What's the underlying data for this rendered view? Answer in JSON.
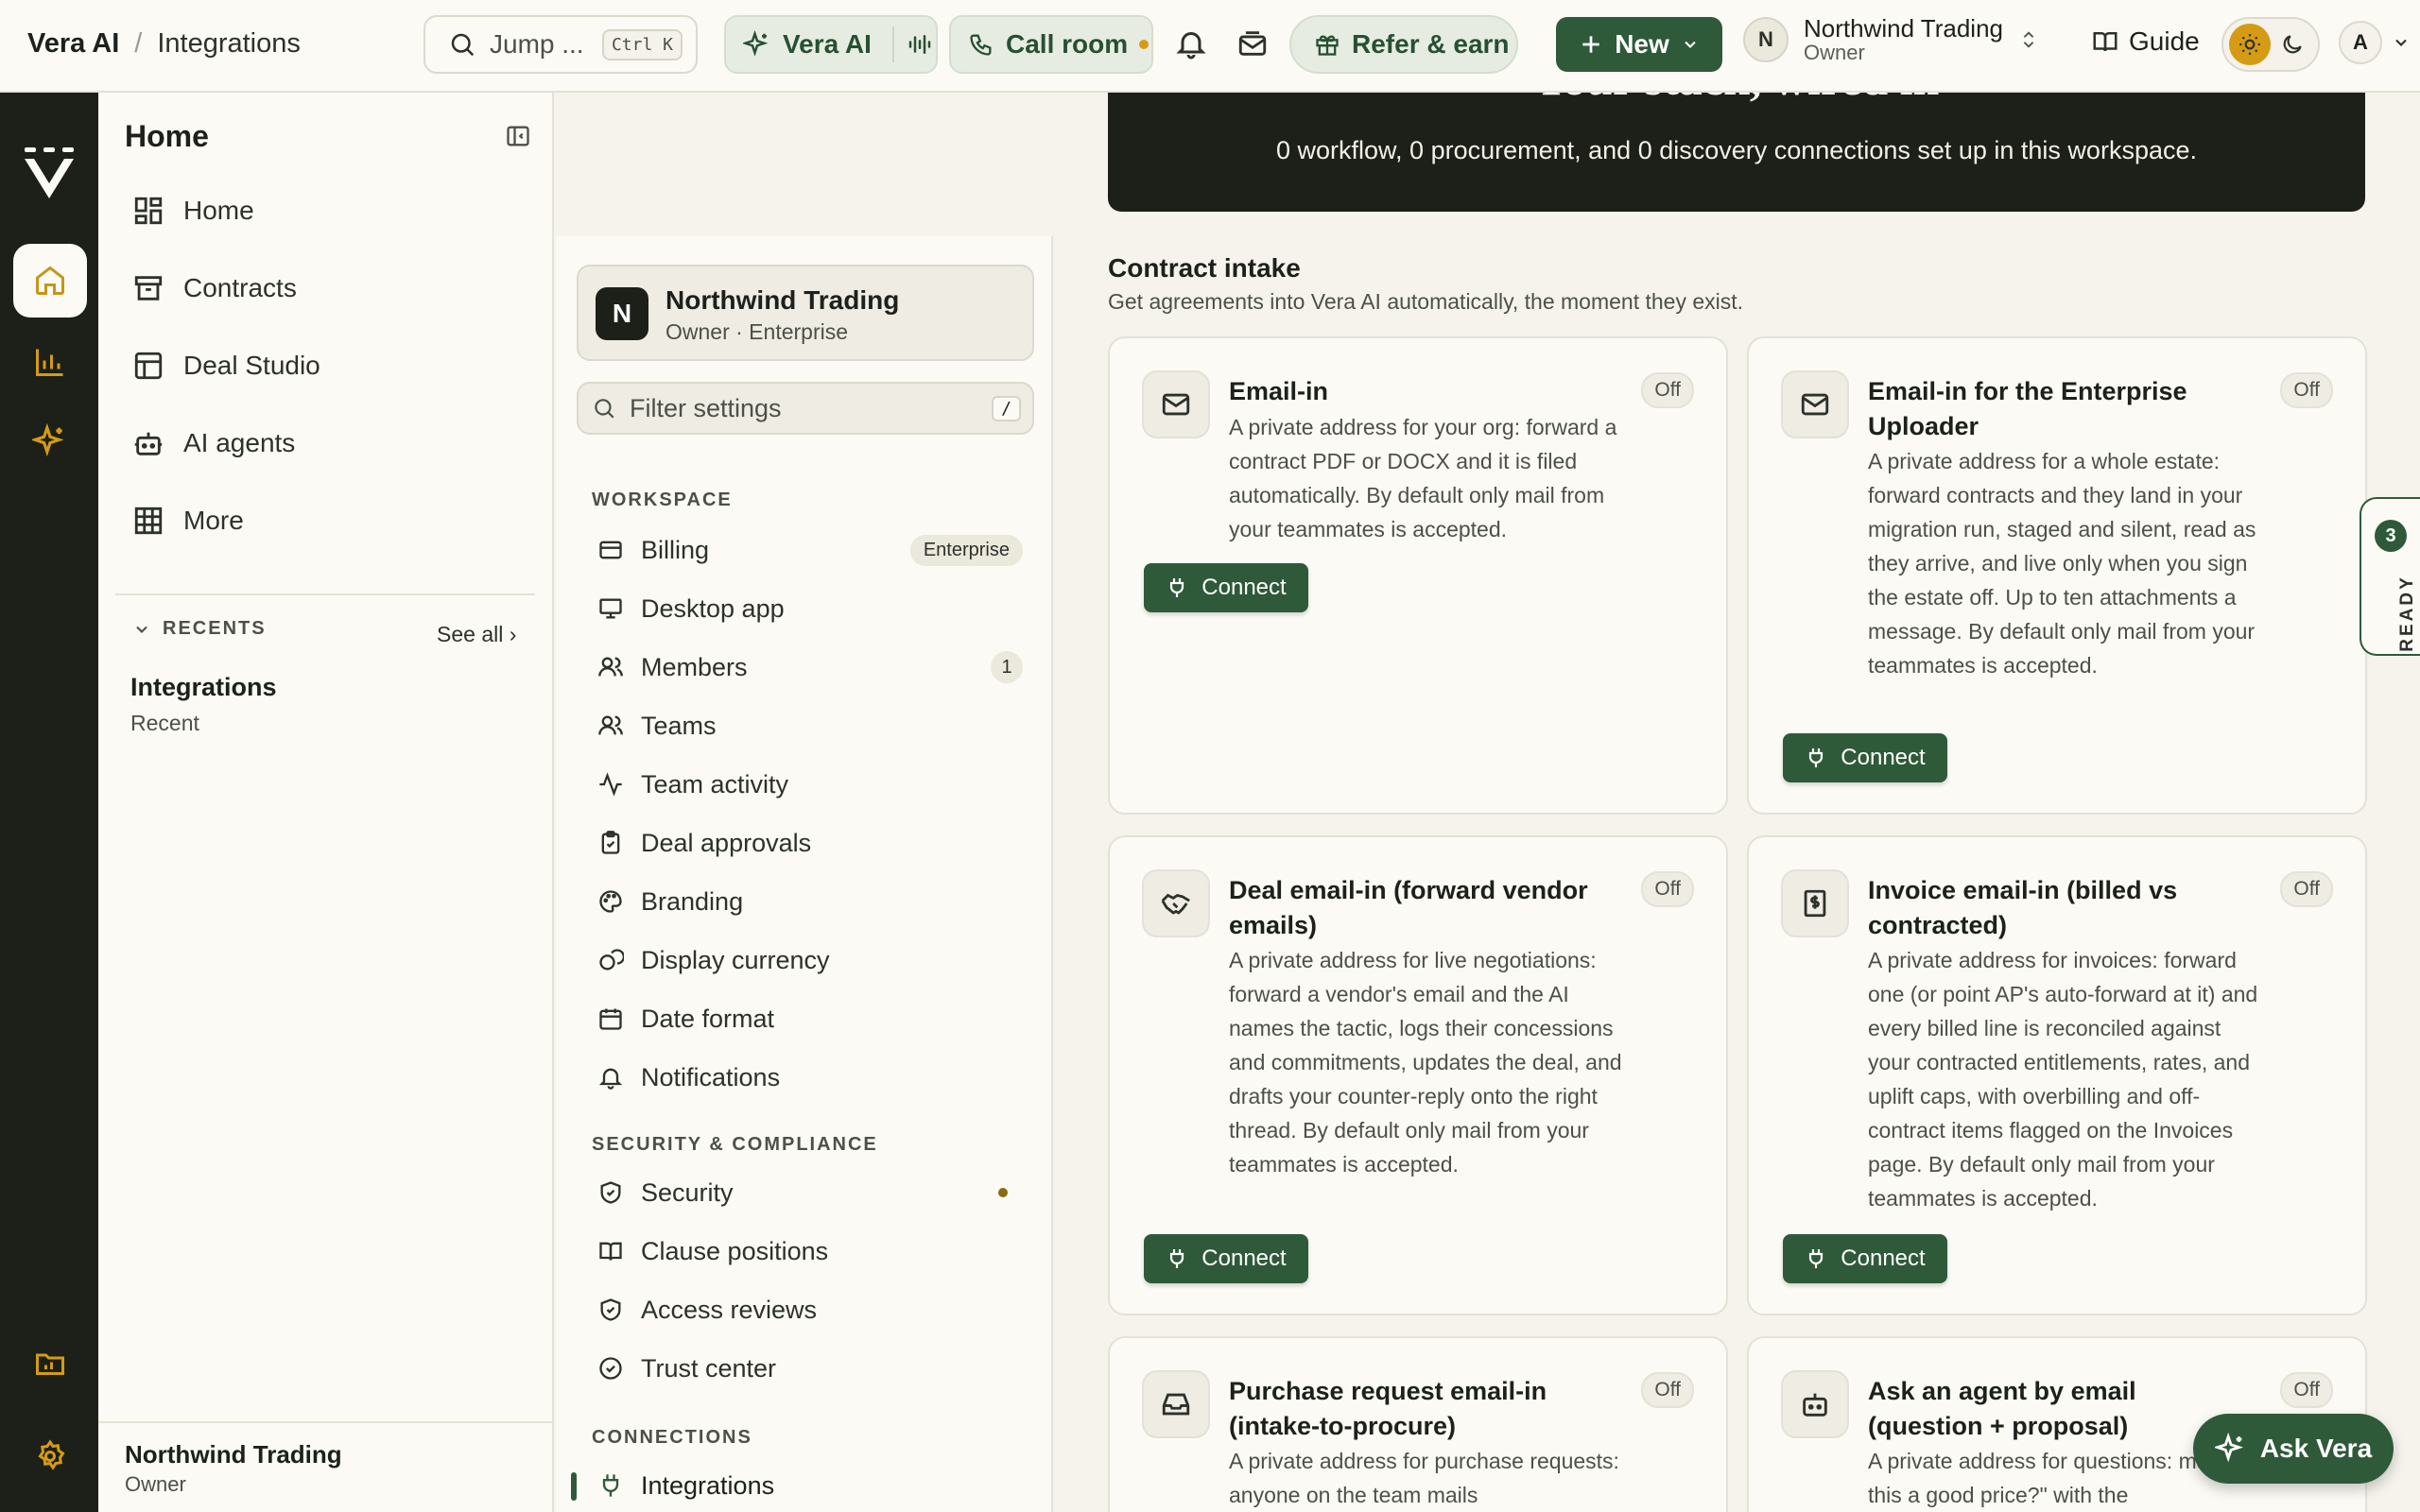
{
  "topbar": {
    "app_name": "Vera AI",
    "separator": "/",
    "page_name": "Integrations",
    "jump_label": "Jump ...",
    "jump_shortcut": "Ctrl K",
    "vera_label": "Vera AI",
    "call_label": "Call room",
    "refer_label": "Refer & earn",
    "new_label": "New",
    "workspace_initial": "N",
    "workspace_name": "Northwind Trading",
    "workspace_role": "Owner",
    "guide_label": "Guide",
    "user_initial": "A"
  },
  "sidebar": {
    "header": "Home",
    "items": [
      {
        "label": "Home",
        "icon": "grid-icon"
      },
      {
        "label": "Contracts",
        "icon": "archive-icon"
      },
      {
        "label": "Deal Studio",
        "icon": "layout-icon"
      },
      {
        "label": "AI agents",
        "icon": "bot-icon"
      },
      {
        "label": "More",
        "icon": "table-icon"
      }
    ],
    "recents_label": "RECENTS",
    "see_all": "See all ›",
    "recent_title": "Integrations",
    "recent_sub": "Recent",
    "footer_name": "Northwind Trading",
    "footer_role": "Owner"
  },
  "settings": {
    "org_initial": "N",
    "org_name": "Northwind Trading",
    "org_sub": "Owner · Enterprise",
    "filter_placeholder": "Filter settings",
    "filter_shortcut": "/",
    "sections": {
      "workspace": "WORKSPACE",
      "security": "SECURITY & COMPLIANCE",
      "connections": "CONNECTIONS"
    },
    "workspace_items": [
      {
        "label": "Billing",
        "badge": "Enterprise"
      },
      {
        "label": "Desktop app"
      },
      {
        "label": "Members",
        "count": "1"
      },
      {
        "label": "Teams"
      },
      {
        "label": "Team activity"
      },
      {
        "label": "Deal approvals"
      },
      {
        "label": "Branding"
      },
      {
        "label": "Display currency"
      },
      {
        "label": "Date format"
      },
      {
        "label": "Notifications"
      }
    ],
    "security_items": [
      {
        "label": "Security"
      },
      {
        "label": "Clause positions"
      },
      {
        "label": "Access reviews"
      },
      {
        "label": "Trust center"
      }
    ],
    "connection_items": [
      {
        "label": "Integrations"
      }
    ]
  },
  "banner": {
    "title": "Your stack, wired in",
    "subtitle": "0 workflow, 0 procurement, and 0 discovery connections set up in this workspace."
  },
  "contract_intake": {
    "title": "Contract intake",
    "description": "Get agreements into Vera AI automatically, the moment they exist.",
    "cards": [
      {
        "title": "Email-in",
        "status": "Off",
        "description": "A private address for your org: forward a contract PDF or DOCX and it is filed automatically. By default only mail from your teammates is accepted.",
        "button": "Connect",
        "icon": "mail-icon"
      },
      {
        "title": "Email-in for the Enterprise Uploader",
        "status": "Off",
        "description": "A private address for a whole estate: forward contracts and they land in your migration run, staged and silent, read as they arrive, and live only when you sign the estate off. Up to ten attachments a message. By default only mail from your teammates is accepted.",
        "button": "Connect",
        "icon": "mail-icon"
      },
      {
        "title": "Deal email-in (forward vendor emails)",
        "status": "Off",
        "description": "A private address for live negotiations: forward a vendor's email and the AI names the tactic, logs their concessions and commitments, updates the deal, and drafts your counter-reply onto the right thread. By default only mail from your teammates is accepted.",
        "button": "Connect",
        "icon": "handshake-icon"
      },
      {
        "title": "Invoice email-in (billed vs contracted)",
        "status": "Off",
        "description": "A private address for invoices: forward one (or point AP's auto-forward at it) and every billed line is reconciled against your contracted entitlements, rates, and uplift caps, with overbilling and off-contract items flagged on the Invoices page. By default only mail from your teammates is accepted.",
        "button": "Connect",
        "icon": "receipt-icon"
      },
      {
        "title": "Purchase request email-in (intake-to-procure)",
        "status": "Off",
        "description": "A private address for purchase requests: anyone on the team mails",
        "icon": "inbox-icon"
      },
      {
        "title": "Ask an agent by email (question + proposal)",
        "status": "Off",
        "description": "A private address for questions: mail \"is this a good price?\" with the",
        "icon": "bot-icon"
      }
    ]
  },
  "ready_tab": {
    "count": "3",
    "label": "READY"
  },
  "ask_vera": {
    "label": "Ask Vera"
  }
}
